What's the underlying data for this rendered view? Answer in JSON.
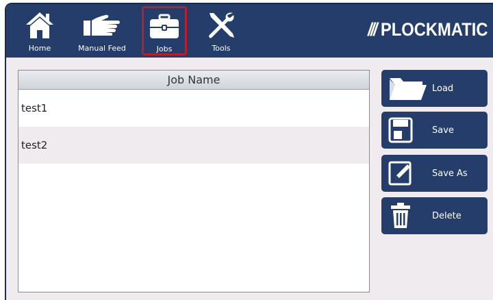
{
  "nav": {
    "items": [
      {
        "label": "Home",
        "icon": "home-icon"
      },
      {
        "label": "Manual Feed",
        "icon": "hand-icon"
      },
      {
        "label": "Jobs",
        "icon": "briefcase-icon",
        "selected": true
      },
      {
        "label": "Tools",
        "icon": "tools-icon"
      }
    ],
    "highlight_color": "#b5202e"
  },
  "brand": {
    "slashes": "///",
    "name": "PLOCKMATIC"
  },
  "jobs_table": {
    "header": "Job Name",
    "rows": [
      "test1",
      "test2"
    ]
  },
  "actions": {
    "load": "Load",
    "save": "Save",
    "save_as": "Save As",
    "delete": "Delete"
  },
  "colors": {
    "primary": "#253d6b",
    "background": "#efebef"
  }
}
